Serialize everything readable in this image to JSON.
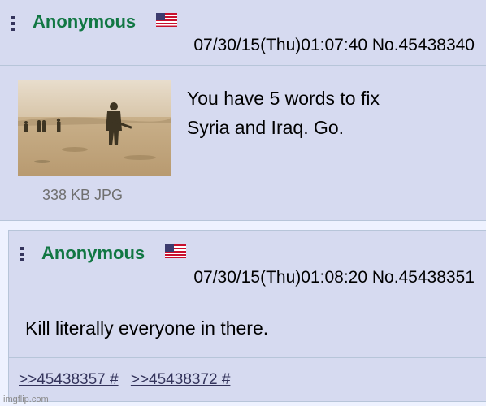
{
  "op": {
    "name": "Anonymous",
    "flag_icon": "us-flag-icon",
    "datetime": "07/30/15(Thu)01:07:40",
    "post_no": "No.45438340",
    "file_info": "338 KB JPG",
    "text_lines": [
      "You have 5 words to fix",
      "Syria and Iraq. Go."
    ]
  },
  "reply": {
    "name": "Anonymous",
    "flag_icon": "us-flag-icon",
    "datetime": "07/30/15(Thu)01:08:20",
    "post_no": "No.45438351",
    "text": "Kill literally everyone in there.",
    "backlinks": [
      ">>45438357 #",
      ">>45438372 #"
    ]
  },
  "watermark": "imgflip.com",
  "colors": {
    "name": "#117743",
    "post_bg": "#d6daf0",
    "border": "#b7c5d9",
    "link": "#34345c"
  }
}
